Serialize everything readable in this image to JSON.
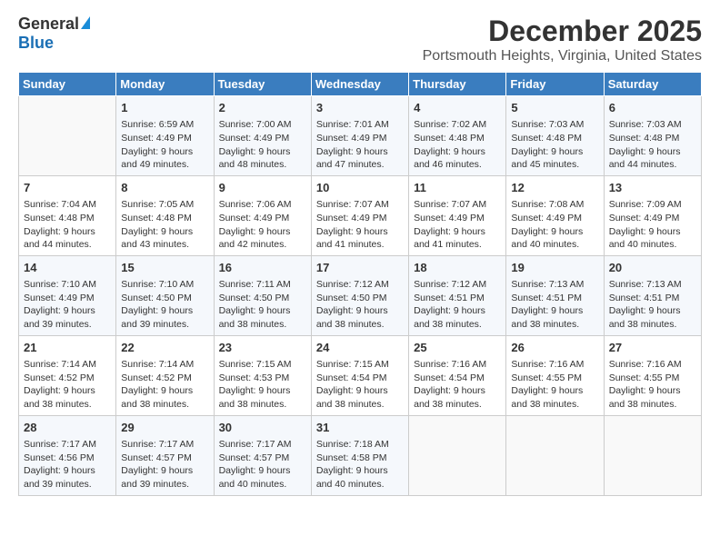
{
  "logo": {
    "general": "General",
    "blue": "Blue"
  },
  "header": {
    "title": "December 2025",
    "subtitle": "Portsmouth Heights, Virginia, United States"
  },
  "calendar": {
    "days_of_week": [
      "Sunday",
      "Monday",
      "Tuesday",
      "Wednesday",
      "Thursday",
      "Friday",
      "Saturday"
    ],
    "weeks": [
      [
        {
          "day": "",
          "sunrise": "",
          "sunset": "",
          "daylight": "",
          "empty": true
        },
        {
          "day": "1",
          "sunrise": "Sunrise: 6:59 AM",
          "sunset": "Sunset: 4:49 PM",
          "daylight": "Daylight: 9 hours and 49 minutes."
        },
        {
          "day": "2",
          "sunrise": "Sunrise: 7:00 AM",
          "sunset": "Sunset: 4:49 PM",
          "daylight": "Daylight: 9 hours and 48 minutes."
        },
        {
          "day": "3",
          "sunrise": "Sunrise: 7:01 AM",
          "sunset": "Sunset: 4:49 PM",
          "daylight": "Daylight: 9 hours and 47 minutes."
        },
        {
          "day": "4",
          "sunrise": "Sunrise: 7:02 AM",
          "sunset": "Sunset: 4:48 PM",
          "daylight": "Daylight: 9 hours and 46 minutes."
        },
        {
          "day": "5",
          "sunrise": "Sunrise: 7:03 AM",
          "sunset": "Sunset: 4:48 PM",
          "daylight": "Daylight: 9 hours and 45 minutes."
        },
        {
          "day": "6",
          "sunrise": "Sunrise: 7:03 AM",
          "sunset": "Sunset: 4:48 PM",
          "daylight": "Daylight: 9 hours and 44 minutes."
        }
      ],
      [
        {
          "day": "7",
          "sunrise": "Sunrise: 7:04 AM",
          "sunset": "Sunset: 4:48 PM",
          "daylight": "Daylight: 9 hours and 44 minutes."
        },
        {
          "day": "8",
          "sunrise": "Sunrise: 7:05 AM",
          "sunset": "Sunset: 4:48 PM",
          "daylight": "Daylight: 9 hours and 43 minutes."
        },
        {
          "day": "9",
          "sunrise": "Sunrise: 7:06 AM",
          "sunset": "Sunset: 4:49 PM",
          "daylight": "Daylight: 9 hours and 42 minutes."
        },
        {
          "day": "10",
          "sunrise": "Sunrise: 7:07 AM",
          "sunset": "Sunset: 4:49 PM",
          "daylight": "Daylight: 9 hours and 41 minutes."
        },
        {
          "day": "11",
          "sunrise": "Sunrise: 7:07 AM",
          "sunset": "Sunset: 4:49 PM",
          "daylight": "Daylight: 9 hours and 41 minutes."
        },
        {
          "day": "12",
          "sunrise": "Sunrise: 7:08 AM",
          "sunset": "Sunset: 4:49 PM",
          "daylight": "Daylight: 9 hours and 40 minutes."
        },
        {
          "day": "13",
          "sunrise": "Sunrise: 7:09 AM",
          "sunset": "Sunset: 4:49 PM",
          "daylight": "Daylight: 9 hours and 40 minutes."
        }
      ],
      [
        {
          "day": "14",
          "sunrise": "Sunrise: 7:10 AM",
          "sunset": "Sunset: 4:49 PM",
          "daylight": "Daylight: 9 hours and 39 minutes."
        },
        {
          "day": "15",
          "sunrise": "Sunrise: 7:10 AM",
          "sunset": "Sunset: 4:50 PM",
          "daylight": "Daylight: 9 hours and 39 minutes."
        },
        {
          "day": "16",
          "sunrise": "Sunrise: 7:11 AM",
          "sunset": "Sunset: 4:50 PM",
          "daylight": "Daylight: 9 hours and 38 minutes."
        },
        {
          "day": "17",
          "sunrise": "Sunrise: 7:12 AM",
          "sunset": "Sunset: 4:50 PM",
          "daylight": "Daylight: 9 hours and 38 minutes."
        },
        {
          "day": "18",
          "sunrise": "Sunrise: 7:12 AM",
          "sunset": "Sunset: 4:51 PM",
          "daylight": "Daylight: 9 hours and 38 minutes."
        },
        {
          "day": "19",
          "sunrise": "Sunrise: 7:13 AM",
          "sunset": "Sunset: 4:51 PM",
          "daylight": "Daylight: 9 hours and 38 minutes."
        },
        {
          "day": "20",
          "sunrise": "Sunrise: 7:13 AM",
          "sunset": "Sunset: 4:51 PM",
          "daylight": "Daylight: 9 hours and 38 minutes."
        }
      ],
      [
        {
          "day": "21",
          "sunrise": "Sunrise: 7:14 AM",
          "sunset": "Sunset: 4:52 PM",
          "daylight": "Daylight: 9 hours and 38 minutes."
        },
        {
          "day": "22",
          "sunrise": "Sunrise: 7:14 AM",
          "sunset": "Sunset: 4:52 PM",
          "daylight": "Daylight: 9 hours and 38 minutes."
        },
        {
          "day": "23",
          "sunrise": "Sunrise: 7:15 AM",
          "sunset": "Sunset: 4:53 PM",
          "daylight": "Daylight: 9 hours and 38 minutes."
        },
        {
          "day": "24",
          "sunrise": "Sunrise: 7:15 AM",
          "sunset": "Sunset: 4:54 PM",
          "daylight": "Daylight: 9 hours and 38 minutes."
        },
        {
          "day": "25",
          "sunrise": "Sunrise: 7:16 AM",
          "sunset": "Sunset: 4:54 PM",
          "daylight": "Daylight: 9 hours and 38 minutes."
        },
        {
          "day": "26",
          "sunrise": "Sunrise: 7:16 AM",
          "sunset": "Sunset: 4:55 PM",
          "daylight": "Daylight: 9 hours and 38 minutes."
        },
        {
          "day": "27",
          "sunrise": "Sunrise: 7:16 AM",
          "sunset": "Sunset: 4:55 PM",
          "daylight": "Daylight: 9 hours and 38 minutes."
        }
      ],
      [
        {
          "day": "28",
          "sunrise": "Sunrise: 7:17 AM",
          "sunset": "Sunset: 4:56 PM",
          "daylight": "Daylight: 9 hours and 39 minutes."
        },
        {
          "day": "29",
          "sunrise": "Sunrise: 7:17 AM",
          "sunset": "Sunset: 4:57 PM",
          "daylight": "Daylight: 9 hours and 39 minutes."
        },
        {
          "day": "30",
          "sunrise": "Sunrise: 7:17 AM",
          "sunset": "Sunset: 4:57 PM",
          "daylight": "Daylight: 9 hours and 40 minutes."
        },
        {
          "day": "31",
          "sunrise": "Sunrise: 7:18 AM",
          "sunset": "Sunset: 4:58 PM",
          "daylight": "Daylight: 9 hours and 40 minutes."
        },
        {
          "day": "",
          "sunrise": "",
          "sunset": "",
          "daylight": "",
          "empty": true
        },
        {
          "day": "",
          "sunrise": "",
          "sunset": "",
          "daylight": "",
          "empty": true
        },
        {
          "day": "",
          "sunrise": "",
          "sunset": "",
          "daylight": "",
          "empty": true
        }
      ]
    ]
  }
}
